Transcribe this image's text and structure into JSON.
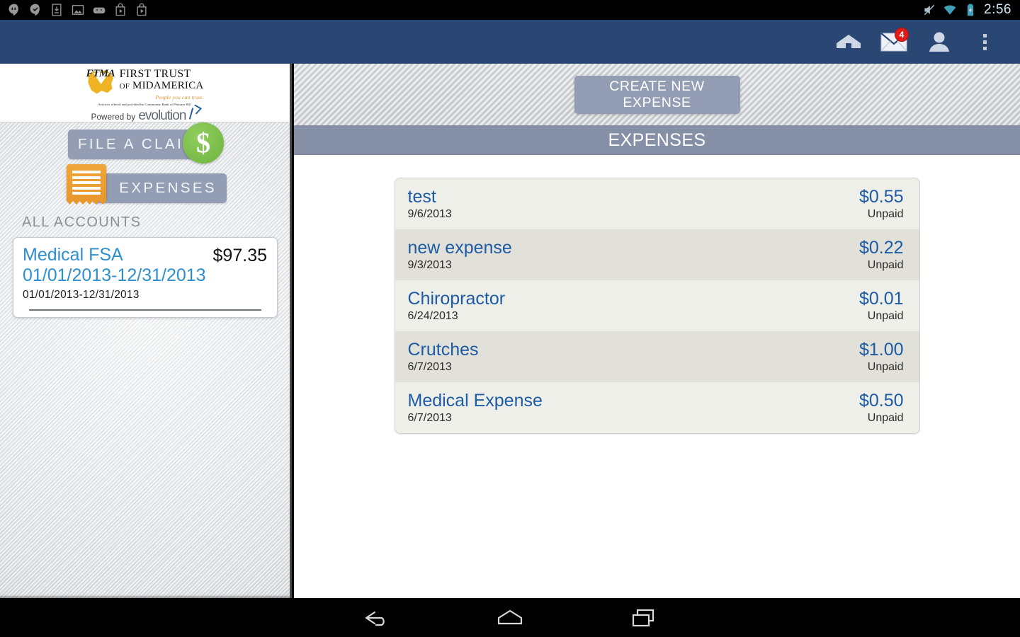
{
  "status_bar": {
    "clock": "2:56",
    "left_icons": [
      "hangouts-icon",
      "checkmark-badge-icon",
      "download-icon",
      "image-icon",
      "android-icon",
      "play-store-icon",
      "play-store-icon"
    ],
    "right_icons": [
      "mute-icon",
      "wifi-icon",
      "battery-charging-icon"
    ]
  },
  "app_bar": {
    "background": "#2a4673",
    "actions": [
      {
        "name": "home-icon",
        "label": "Home"
      },
      {
        "name": "messages-icon",
        "label": "Messages",
        "badge": "4"
      },
      {
        "name": "profile-icon",
        "label": "Profile"
      },
      {
        "name": "overflow-menu-icon",
        "label": "More options"
      }
    ]
  },
  "sidebar": {
    "logo": {
      "mark": "FTMA",
      "line1": "FIRST TRUST",
      "line2_prefix": "OF",
      "line2": "MIDAMERICA",
      "tagline": "People you can trust.",
      "disclaimer": "Services offered and provided by Community Bank of Pleasant Hill",
      "powered_by": "Powered by",
      "powered_brand": "evolution"
    },
    "nav": [
      {
        "name": "file-a-claim",
        "label": "FILE A CLAIM",
        "icon": "dollar-circle-icon",
        "icon_color": "#7bc043"
      },
      {
        "name": "expenses",
        "label": "EXPENSES",
        "icon": "receipt-icon",
        "icon_color": "#e8982d"
      }
    ],
    "accounts_heading": "ALL ACCOUNTS",
    "account_card": {
      "name": "Medical FSA 01/01/2013-12/31/2013",
      "balance": "$97.35",
      "period": "01/01/2013-12/31/2013"
    }
  },
  "main": {
    "create_button": "CREATE NEW EXPENSE",
    "section_title": "EXPENSES",
    "expenses": [
      {
        "title": "test",
        "date": "9/6/2013",
        "amount": "$0.55",
        "status": "Unpaid"
      },
      {
        "title": "new expense",
        "date": "9/3/2013",
        "amount": "$0.22",
        "status": "Unpaid"
      },
      {
        "title": "Chiropractor",
        "date": "6/24/2013",
        "amount": "$0.01",
        "status": "Unpaid"
      },
      {
        "title": "Crutches",
        "date": "6/7/2013",
        "amount": "$1.00",
        "status": "Unpaid"
      },
      {
        "title": "Medical Expense",
        "date": "6/7/2013",
        "amount": "$0.50",
        "status": "Unpaid"
      }
    ]
  },
  "nav_bar": {
    "keys": [
      {
        "name": "back-button",
        "label": "Back"
      },
      {
        "name": "home-button",
        "label": "Home"
      },
      {
        "name": "recents-button",
        "label": "Recent apps"
      }
    ]
  }
}
